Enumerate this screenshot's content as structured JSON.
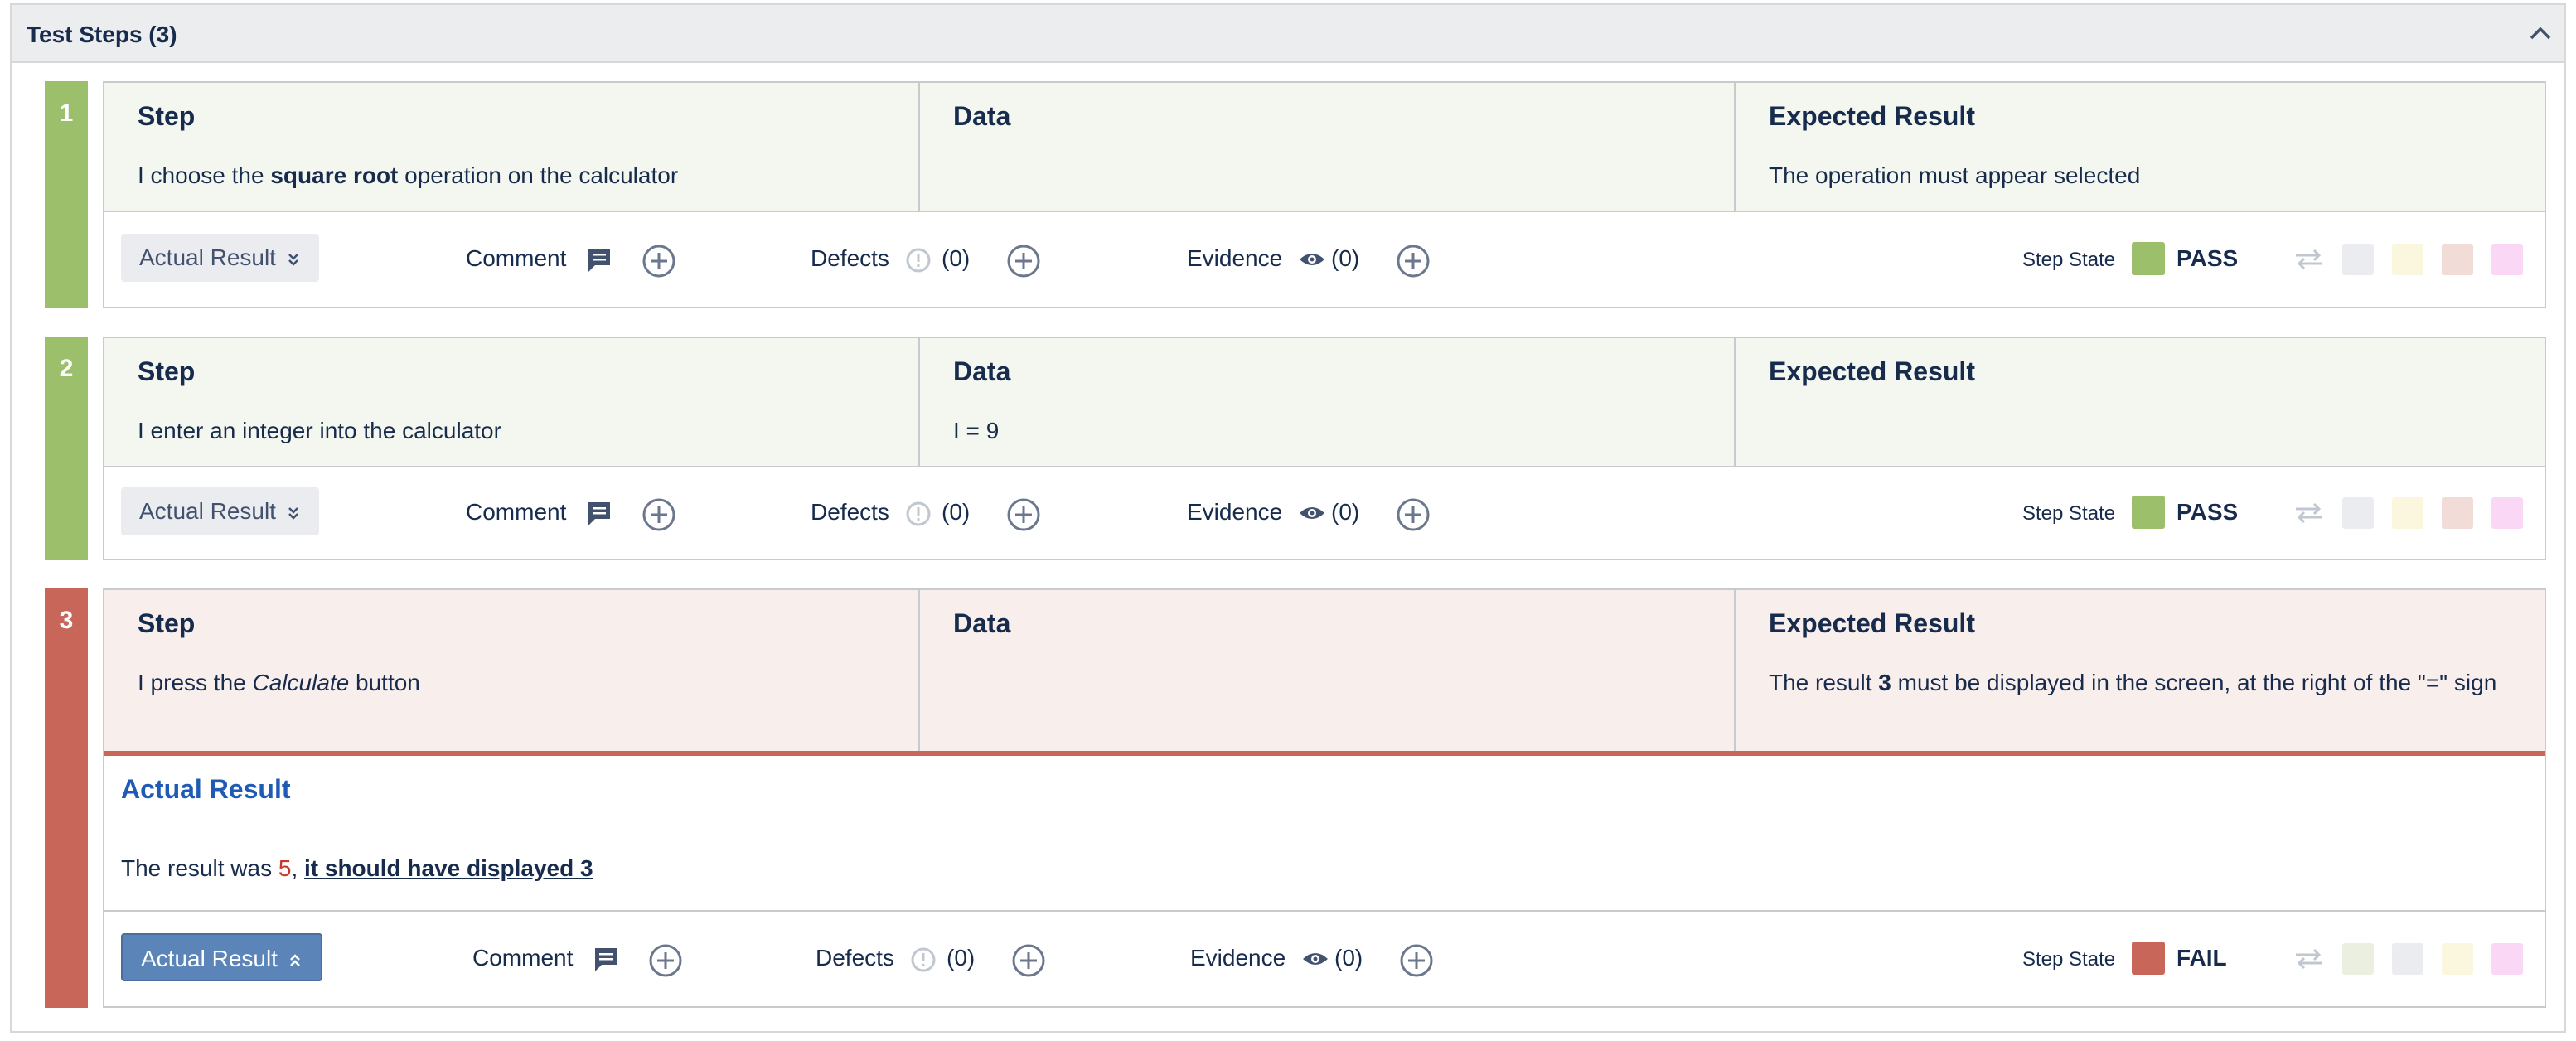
{
  "panel": {
    "title": "Test Steps (3)",
    "collapse_icon": "chevron-up-icon"
  },
  "labels": {
    "step": "Step",
    "data": "Data",
    "expected": "Expected Result",
    "actual_result": "Actual Result",
    "comment": "Comment",
    "defects": "Defects",
    "evidence": "Evidence",
    "step_state": "Step State"
  },
  "colors": {
    "pass": "#9bbf6b",
    "fail": "#c9665a",
    "pass_bg": "#f4f7ef",
    "fail_bg": "#f8eeec",
    "accent_blue": "#5b84b8"
  },
  "steps": [
    {
      "number": "1",
      "step_pre": "I choose the ",
      "step_bold": "square root",
      "step_post": " operation on the calculator",
      "data": "",
      "expected": "The operation must appear selected",
      "defects_count": "(0)",
      "evidence_count": "(0)",
      "state": "PASS"
    },
    {
      "number": "2",
      "step_text": "I enter an integer into the calculator",
      "data": "I = 9",
      "expected": "",
      "defects_count": "(0)",
      "evidence_count": "(0)",
      "state": "PASS"
    },
    {
      "number": "3",
      "step_pre": "I press the ",
      "step_italic": "Calculate",
      "step_post": " button",
      "data": "",
      "expected_pre": "The result ",
      "expected_bold": "3",
      "expected_post": " must be displayed in the screen, at the right of the \"=\" sign",
      "actual_result": {
        "title": "Actual Result",
        "text_pre": "The result was ",
        "text_num": "5",
        "text_sep": ", ",
        "text_link": "it should have displayed 3"
      },
      "defects_count": "(0)",
      "evidence_count": "(0)",
      "state": "FAIL"
    }
  ]
}
